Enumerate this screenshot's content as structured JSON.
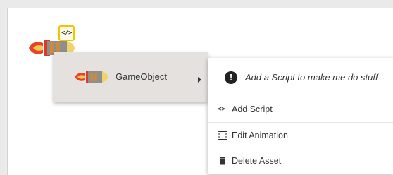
{
  "object_menu": {
    "object_label": "GameObject",
    "object_icon": "rocket-icon",
    "badge_icon": "code-tag-icon",
    "badge_text": "</>"
  },
  "context_menu": {
    "hint_icon": "exclamation-circle-icon",
    "hint_glyph": "!",
    "hint_text": "Add a Script to make me do stuff",
    "items": [
      {
        "label": "Add Script",
        "icon": "code-icon",
        "glyph": "<>"
      },
      {
        "label": "Edit Animation",
        "icon": "film-icon"
      },
      {
        "label": "Delete Asset",
        "icon": "trash-icon"
      }
    ]
  },
  "colors": {
    "badge_border": "#f2c400",
    "submenu_bg": "#e4e1df",
    "page_bg": "#ebeaea"
  }
}
